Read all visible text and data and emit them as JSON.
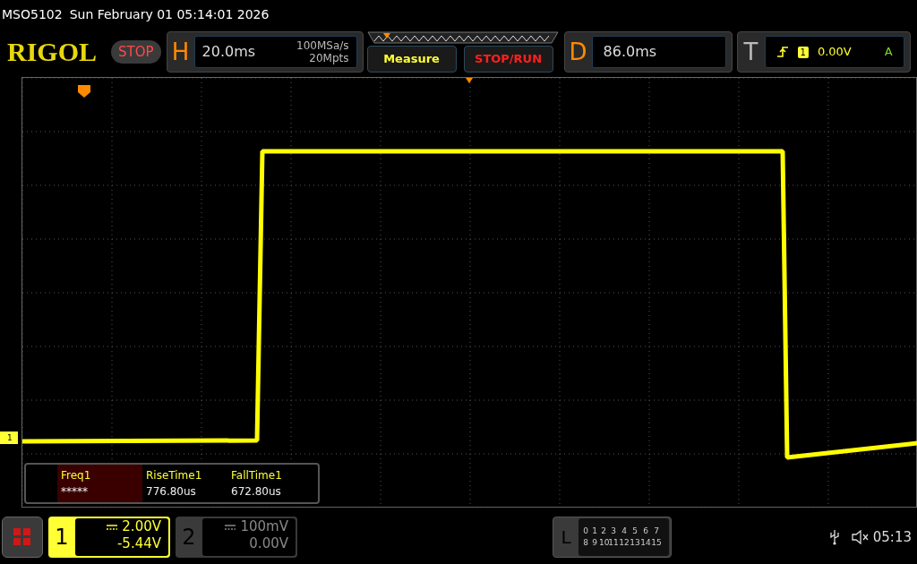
{
  "status_bar": {
    "model": "MSO5102",
    "datetime": "Sun February 01 05:14:01 2026"
  },
  "toolbar": {
    "logo": "RIGOL",
    "run_state": "STOP",
    "horizontal": {
      "label": "H",
      "timebase": "20.0ms",
      "sample_rate": "100MSa/s",
      "memory_depth": "20Mpts"
    },
    "buttons": [
      {
        "label": "Measure",
        "kind": "measure"
      },
      {
        "label": "STOP/RUN",
        "kind": "run"
      }
    ],
    "delay": {
      "label": "D",
      "value": "86.0ms"
    },
    "trigger": {
      "label": "T",
      "source": "1",
      "level": "0.00V",
      "mode": "A"
    }
  },
  "graticule": {
    "channel_marker": "1"
  },
  "measurements": [
    {
      "name": "Freq1",
      "value": "*****",
      "selected": true
    },
    {
      "name": "RiseTime1",
      "value": "776.80us",
      "selected": false
    },
    {
      "name": "FallTime1",
      "value": "672.80us",
      "selected": false
    }
  ],
  "channels": [
    {
      "number": "1",
      "scale": "2.00V",
      "offset": "-5.44V",
      "selected": true
    },
    {
      "number": "2",
      "scale": "100mV",
      "offset": "0.00V",
      "selected": false
    }
  ],
  "logic": {
    "label": "L",
    "rows": [
      [
        "0",
        "1",
        "2",
        "3",
        "4",
        "5",
        "6",
        "7"
      ],
      [
        "8",
        "9",
        "10",
        "11",
        "12",
        "13",
        "14",
        "15"
      ]
    ]
  },
  "clock": "05:13"
}
